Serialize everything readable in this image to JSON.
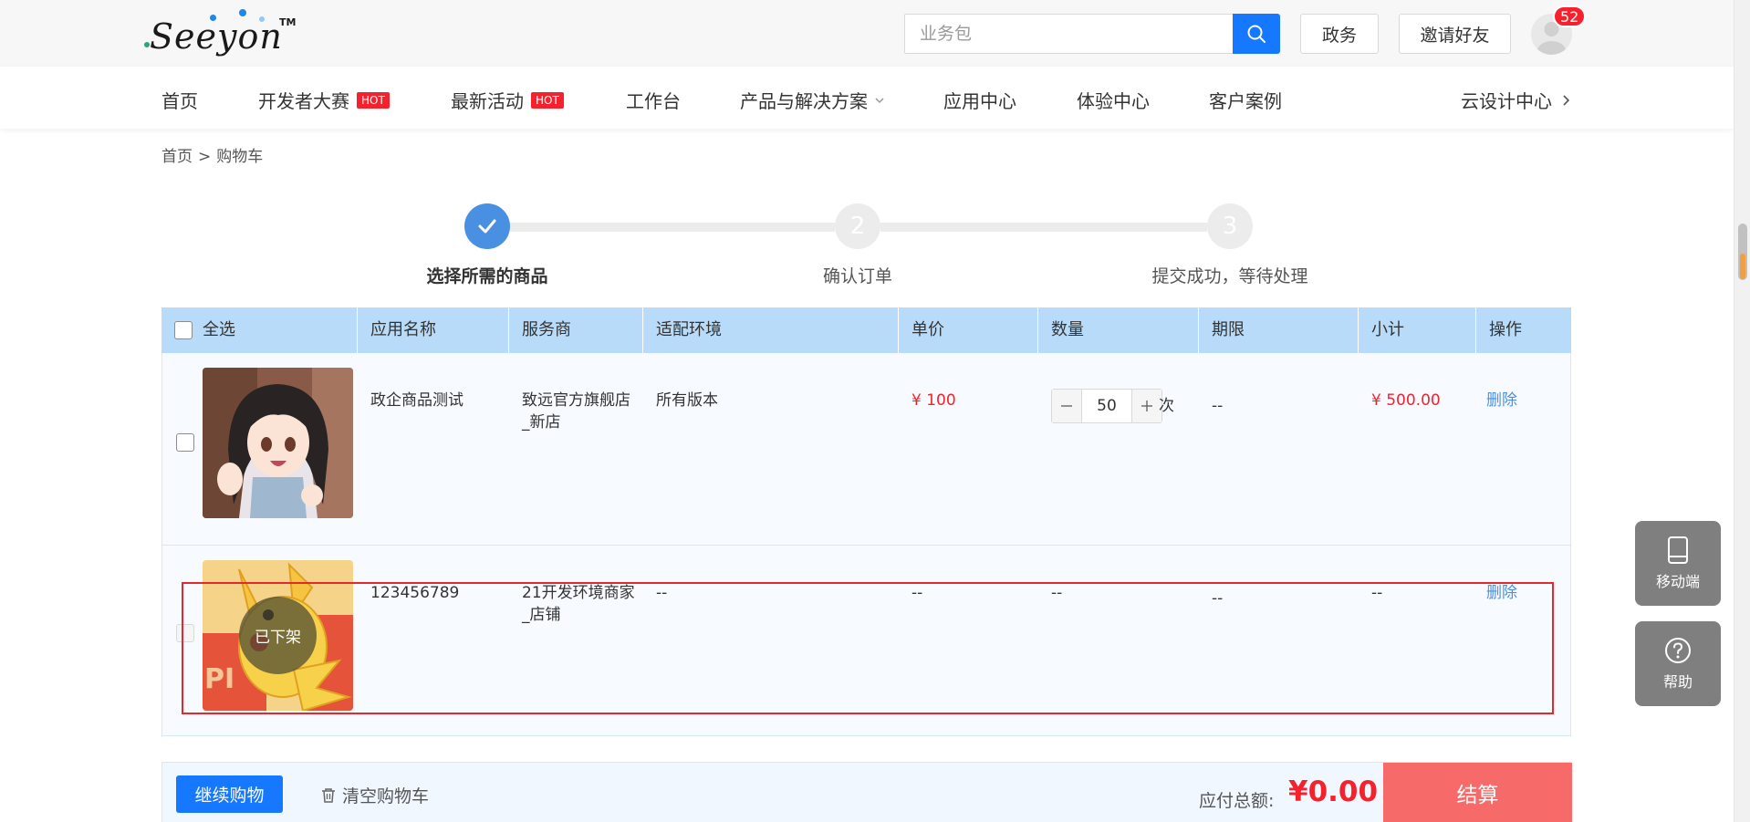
{
  "header": {
    "logo_text": "Seeyon",
    "logo_tm": "TM",
    "search_placeholder": "业务包",
    "gov_button": "政务",
    "invite_button": "邀请好友",
    "notification_count": "52",
    "accent_color": "#1677ff"
  },
  "nav": {
    "items": [
      {
        "label": "首页"
      },
      {
        "label": "开发者大赛",
        "tag": "HOT"
      },
      {
        "label": "最新活动",
        "tag": "HOT"
      },
      {
        "label": "工作台"
      },
      {
        "label": "产品与解决方案"
      },
      {
        "label": "应用中心"
      },
      {
        "label": "体验中心"
      },
      {
        "label": "客户案例"
      },
      {
        "label": "云设计中心"
      }
    ]
  },
  "breadcrumb": {
    "home": "首页",
    "separator": ">",
    "current": "购物车"
  },
  "steps": [
    {
      "number": "1",
      "label": "选择所需的商品",
      "status": "done"
    },
    {
      "number": "2",
      "label": "确认订单",
      "status": "pending"
    },
    {
      "number": "3",
      "label": "提交成功，等待处理",
      "status": "pending"
    }
  ],
  "table": {
    "columns": [
      "全选",
      "应用名称",
      "服务商",
      "适配环境",
      "单价",
      "数量",
      "期限",
      "小计",
      "操作"
    ],
    "rows": [
      {
        "name": "政企商品测试",
        "vendor_line1": "致远官方旗舰店",
        "vendor_line2": "_新店",
        "env": "所有版本",
        "price": "¥ 100",
        "quantity": "50",
        "unit": "次",
        "term": "--",
        "subtotal": "¥ 500.00",
        "action": "删除",
        "image": "anime-girl-thumbnail"
      },
      {
        "name": "123456789",
        "vendor_line1": "21开发环境商家",
        "vendor_line2": "_店铺",
        "env": "--",
        "price": "--",
        "quantity": "--",
        "term": "--",
        "subtotal": "--",
        "action": "删除",
        "overlay": "已下架",
        "image": "pikachu-thumbnail"
      }
    ]
  },
  "footer": {
    "continue_button": "继续购物",
    "clear_button": "清空购物车",
    "total_label": "应付总额:",
    "total_value": "¥0.00",
    "checkout_button": "结算"
  },
  "floating": {
    "mobile": "移动端",
    "help": "帮助"
  }
}
